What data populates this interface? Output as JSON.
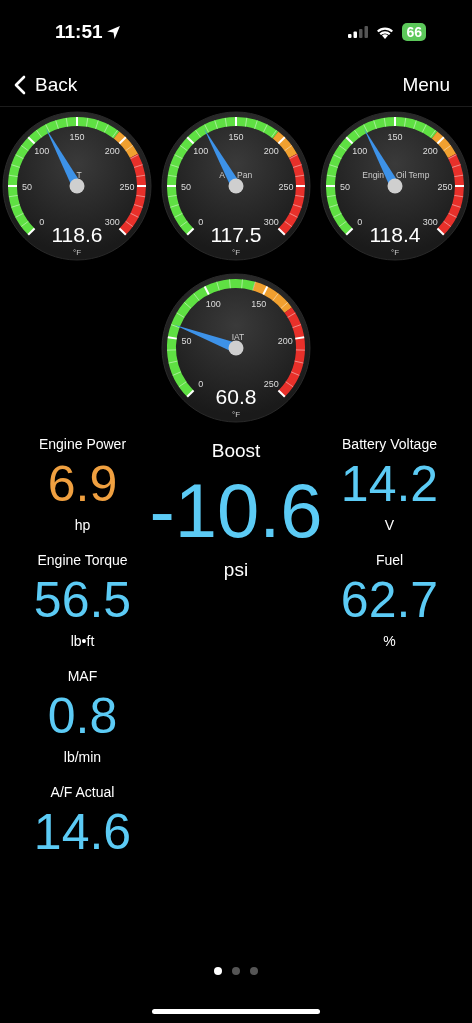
{
  "status_bar": {
    "time": "11:51",
    "battery": "66"
  },
  "nav": {
    "back": "Back",
    "menu": "Menu"
  },
  "gauges": [
    {
      "label_parts": [
        "T"
      ],
      "ticks": [
        "0",
        "50",
        "100",
        "150",
        "200",
        "250",
        "300"
      ],
      "value": "118.6",
      "unit": "°F",
      "zones": [
        {
          "color": "#5fe043"
        },
        {
          "color": "#f0a030"
        },
        {
          "color": "#e8302a"
        }
      ]
    },
    {
      "label_parts": [
        "A",
        "Pan"
      ],
      "ticks": [
        "0",
        "50",
        "100",
        "150",
        "200",
        "250",
        "300"
      ],
      "value": "117.5",
      "unit": "°F",
      "zones": [
        {
          "color": "#5fe043"
        },
        {
          "color": "#f0a030"
        },
        {
          "color": "#e8302a"
        }
      ]
    },
    {
      "label_parts": [
        "Engin",
        "Oil Temp"
      ],
      "ticks": [
        "0",
        "50",
        "100",
        "150",
        "200",
        "250",
        "300"
      ],
      "value": "118.4",
      "unit": "°F",
      "zones": [
        {
          "color": "#5fe043"
        },
        {
          "color": "#f0a030"
        },
        {
          "color": "#e8302a"
        }
      ]
    },
    {
      "label_parts": [
        "IAT"
      ],
      "ticks": [
        "0",
        "50",
        "100",
        "150",
        "200",
        "250"
      ],
      "value": "60.8",
      "unit": "°F",
      "zones": [
        {
          "color": "#5fe043"
        },
        {
          "color": "#f0a030"
        },
        {
          "color": "#e8302a"
        }
      ]
    }
  ],
  "columns": [
    [
      {
        "label": "Engine Power",
        "value": "6.9",
        "unit": "hp",
        "color": "#f0a040"
      },
      {
        "label": "Engine Torque",
        "value": "56.5",
        "unit": "lb•ft",
        "color": "#5ccbf5"
      },
      {
        "label": "MAF",
        "value": "0.8",
        "unit": "lb/min",
        "color": "#5ccbf5"
      },
      {
        "label": "A/F Actual",
        "value": "14.6",
        "color": "#5ccbf5"
      }
    ],
    [
      {
        "label": "Boost",
        "value": "-10.6",
        "unit": "psi",
        "color": "#5ccbf5",
        "kind": "large"
      }
    ],
    [
      {
        "label": "Battery Voltage",
        "value": "14.2",
        "unit": "V",
        "color": "#5ccbf5"
      },
      {
        "label": "Fuel",
        "value": "62.7",
        "unit": "%",
        "color": "#5ccbf5"
      }
    ]
  ],
  "pages": [
    {
      "selected": true
    },
    {
      "selected": false
    },
    {
      "selected": false
    }
  ]
}
